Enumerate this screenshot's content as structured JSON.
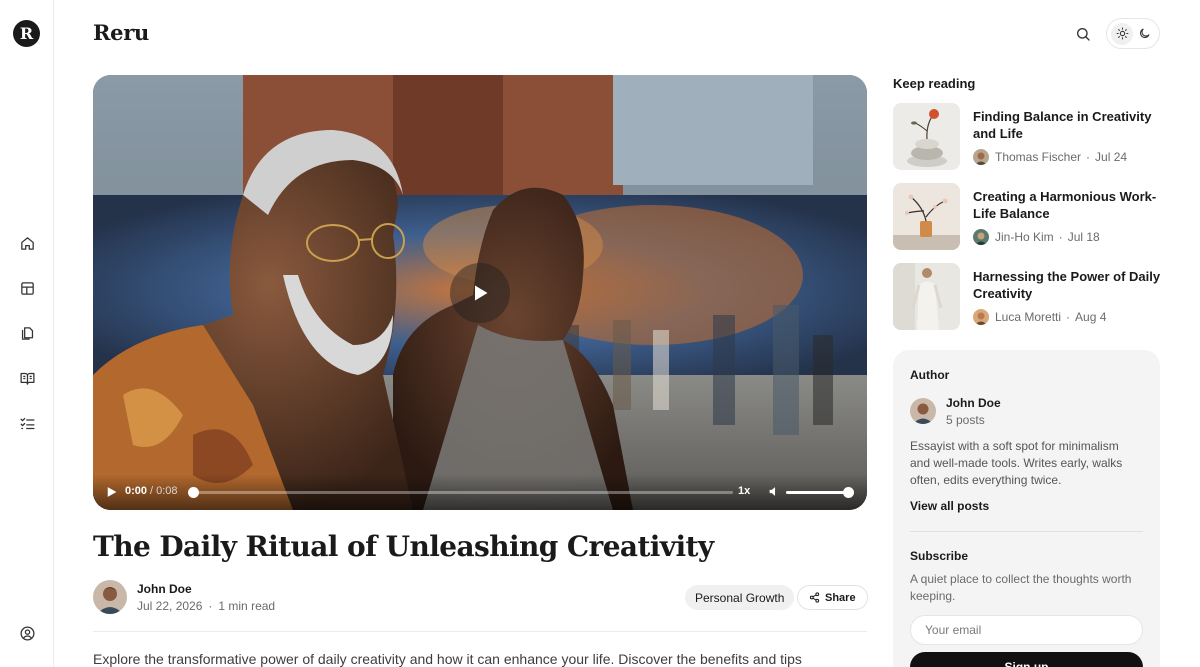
{
  "app": {
    "brand": "Reru",
    "logo_letter": "R"
  },
  "rail": {
    "items": [
      {
        "name": "home",
        "icon": "home-icon"
      },
      {
        "name": "layout",
        "icon": "layout-icon"
      },
      {
        "name": "pages",
        "icon": "copy-icon"
      },
      {
        "name": "reading",
        "icon": "book-open-icon"
      },
      {
        "name": "tasks",
        "icon": "checklist-icon"
      }
    ],
    "profile_icon": "user-circle-icon"
  },
  "header": {
    "search_icon": "search-icon",
    "theme": {
      "light_icon": "sun-icon",
      "dark_icon": "moon-icon",
      "active": "light"
    }
  },
  "video": {
    "current_time": "0:00",
    "duration": "0:08",
    "separator": "/",
    "progress": 0.0,
    "speed": "1x",
    "volume": 1.0
  },
  "article": {
    "title": "The Daily Ritual of Unleashing Creativity",
    "author": "John Doe",
    "date": "Jul 22, 2026",
    "read_time": "1 min read",
    "tag": "Personal Growth",
    "share_label": "Share",
    "excerpt": "Explore the transformative power of daily creativity and how it can enhance your life. Discover the benefits and tips"
  },
  "keep_reading": {
    "heading": "Keep reading",
    "items": [
      {
        "title": "Finding Balance in Creativity and Life",
        "author": "Thomas Fischer",
        "date": "Jul 24"
      },
      {
        "title": "Creating a Harmonious Work-Life Balance",
        "author": "Jin-Ho Kim",
        "date": "Jul 18"
      },
      {
        "title": "Harnessing the Power of Daily Creativity",
        "author": "Luca Moretti",
        "date": "Aug 4"
      }
    ]
  },
  "author_card": {
    "label": "Author",
    "name": "John Doe",
    "posts": "5 posts",
    "bio": "Essayist with a soft spot for minimalism and well-made tools. Writes early, walks often, edits everything twice.",
    "link": "View all posts"
  },
  "subscribe": {
    "label": "Subscribe",
    "description": "A quiet place to collect the thoughts worth keeping.",
    "placeholder": "Your email",
    "button": "Sign up"
  },
  "colors": {
    "text": "#1a1a1a",
    "muted": "#6b6b6b",
    "card_bg": "#f4f4f4",
    "button_dark": "#111111"
  }
}
